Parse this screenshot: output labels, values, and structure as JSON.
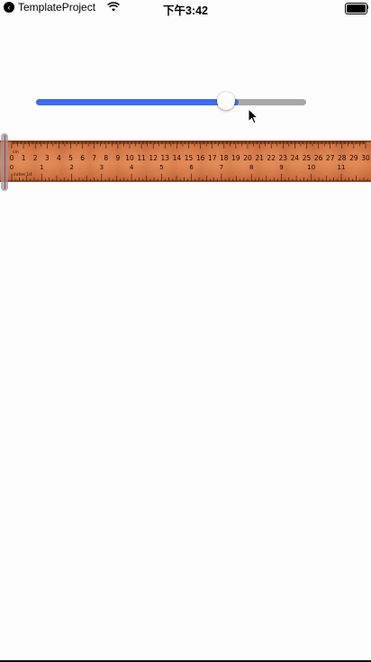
{
  "status_bar": {
    "back_app_label": "TemplateProject",
    "back_icon": "chevron-left-icon",
    "wifi_icon": "wifi-icon",
    "time": "下午3:42",
    "battery_icon": "battery-full-icon"
  },
  "slider": {
    "value": 0.75,
    "min": 0,
    "max": 1,
    "fill_color": "#3d6cf1",
    "track_color": "#a8a8a8"
  },
  "ruler": {
    "unit_top": "cm",
    "unit_bottom": "inches 1/4",
    "cm_labels": [
      "0",
      "1",
      "2",
      "3",
      "4",
      "5",
      "6",
      "7",
      "8",
      "9",
      "10",
      "11",
      "12",
      "13",
      "14",
      "15",
      "16",
      "17",
      "18",
      "19",
      "20",
      "21",
      "22",
      "23",
      "24",
      "25",
      "26",
      "27",
      "28",
      "29",
      "30"
    ],
    "inch_labels": [
      "0",
      "1",
      "2",
      "3",
      "4",
      "5",
      "6",
      "7",
      "8",
      "9",
      "10",
      "11"
    ],
    "marker_color": "#c0392b"
  }
}
